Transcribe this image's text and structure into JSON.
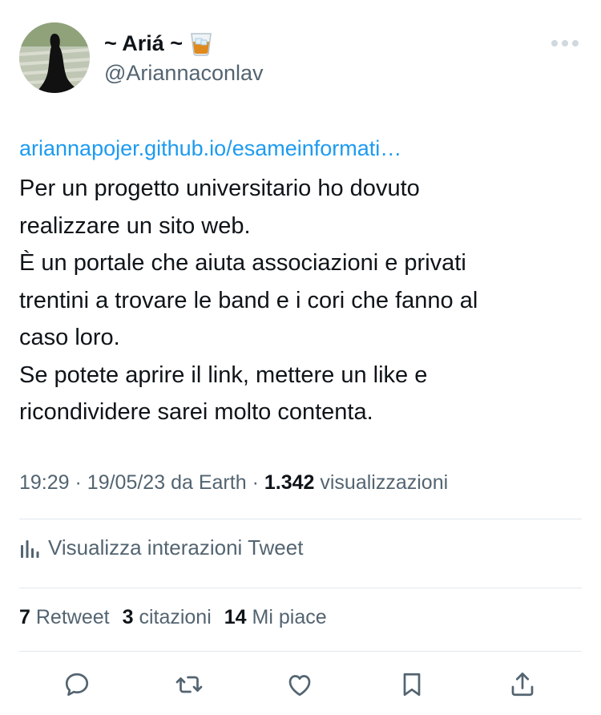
{
  "author": {
    "display_name": "~ Ariá ~",
    "emoji": "🥃",
    "handle": "@Ariannaconlav"
  },
  "tweet": {
    "link_text": "ariannapojer.github.io/esameinformati…",
    "lines": [
      "Per un progetto universitario ho dovuto",
      "realizzare un sito web.",
      "È un portale che aiuta associazioni e privati",
      "trentini a trovare le band e i cori che fanno al",
      "caso loro.",
      "Se potete aprire il link, mettere un like e",
      "ricondividere sarei molto contenta."
    ]
  },
  "meta": {
    "time": "19:29",
    "date": "19/05/23",
    "source_prefix": "da",
    "source": "Earth",
    "views_count": "1.342",
    "views_label": "visualizzazioni"
  },
  "analytics": {
    "label": "Visualizza interazioni Tweet",
    "icon": "analytics-icon"
  },
  "stats": {
    "retweets_count": "7",
    "retweets_label": "Retweet",
    "quotes_count": "3",
    "quotes_label": "citazioni",
    "likes_count": "14",
    "likes_label": "Mi piace"
  },
  "actions": {
    "icons": [
      "reply-icon",
      "retweet-icon",
      "like-icon",
      "bookmark-icon",
      "share-icon"
    ]
  },
  "colors": {
    "link": "#1d9bf0",
    "text": "#0f1419",
    "secondary": "#536471",
    "divider": "#e1e8ed"
  }
}
